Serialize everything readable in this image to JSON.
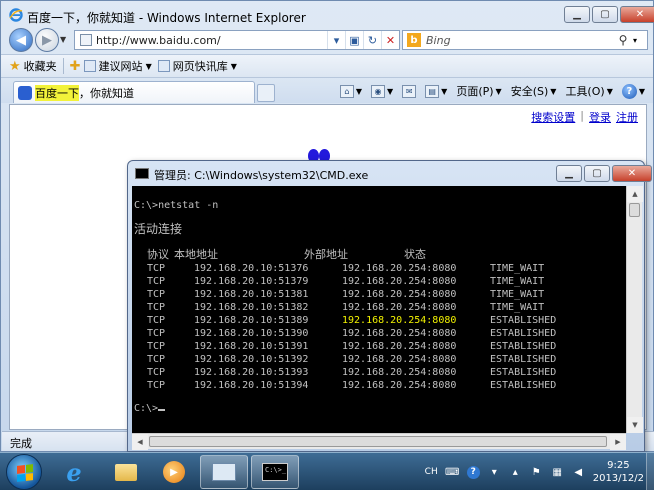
{
  "ie": {
    "title": "百度一下，你就知道 - Windows Internet Explorer",
    "address": "http://www.baidu.com/",
    "search_engine": "Bing",
    "favorites": {
      "label": "收藏夹",
      "suggested": "建议网站",
      "gallery": "网页快讯库"
    },
    "tab_title_highlight": "百度一下",
    "tab_title_rest": "，你就知道",
    "commands": {
      "page": "页面(P)",
      "safety": "安全(S)",
      "tools": "工具(O)"
    },
    "status": "完成",
    "links": {
      "search_settings": "搜索设置",
      "login": "登录",
      "register": "注册",
      "separator": "|"
    }
  },
  "cmd": {
    "title": "管理员: C:\\Windows\\system32\\CMD.exe",
    "command_line": "C:\\>netstat -n",
    "section_title": "活动连接",
    "headers": [
      "协议",
      "本地地址",
      "外部地址",
      "状态"
    ],
    "connections": [
      {
        "proto": "TCP",
        "local": "192.168.20.10:51376",
        "foreign": "192.168.20.254:8080",
        "state": "TIME_WAIT",
        "highlight": false
      },
      {
        "proto": "TCP",
        "local": "192.168.20.10:51379",
        "foreign": "192.168.20.254:8080",
        "state": "TIME_WAIT",
        "highlight": false
      },
      {
        "proto": "TCP",
        "local": "192.168.20.10:51381",
        "foreign": "192.168.20.254:8080",
        "state": "TIME_WAIT",
        "highlight": false
      },
      {
        "proto": "TCP",
        "local": "192.168.20.10:51382",
        "foreign": "192.168.20.254:8080",
        "state": "TIME_WAIT",
        "highlight": false
      },
      {
        "proto": "TCP",
        "local": "192.168.20.10:51389",
        "foreign": "192.168.20.254:8080",
        "state": "ESTABLISHED",
        "highlight": true
      },
      {
        "proto": "TCP",
        "local": "192.168.20.10:51390",
        "foreign": "192.168.20.254:8080",
        "state": "ESTABLISHED",
        "highlight": false
      },
      {
        "proto": "TCP",
        "local": "192.168.20.10:51391",
        "foreign": "192.168.20.254:8080",
        "state": "ESTABLISHED",
        "highlight": false
      },
      {
        "proto": "TCP",
        "local": "192.168.20.10:51392",
        "foreign": "192.168.20.254:8080",
        "state": "ESTABLISHED",
        "highlight": false
      },
      {
        "proto": "TCP",
        "local": "192.168.20.10:51393",
        "foreign": "192.168.20.254:8080",
        "state": "ESTABLISHED",
        "highlight": false
      },
      {
        "proto": "TCP",
        "local": "192.168.20.10:51394",
        "foreign": "192.168.20.254:8080",
        "state": "ESTABLISHED",
        "highlight": false
      }
    ],
    "prompt": "C:\\>",
    "highlight_color": "#f2f200"
  },
  "taskbar": {
    "cmd_thumb_text": "C:\\>_",
    "lang": "CH",
    "time": "9:25",
    "date": "2013/12/2"
  },
  "icons": [
    "ie-favicon-icon",
    "back-icon",
    "forward-icon",
    "refresh-icon",
    "stop-icon",
    "bing-icon",
    "search-icon",
    "star-icon",
    "home-icon",
    "rss-icon",
    "mail-icon",
    "print-icon",
    "help-icon",
    "cmd-icon",
    "start-icon",
    "folder-icon",
    "media-player-icon",
    "network-icon",
    "flag-icon",
    "volume-icon"
  ]
}
